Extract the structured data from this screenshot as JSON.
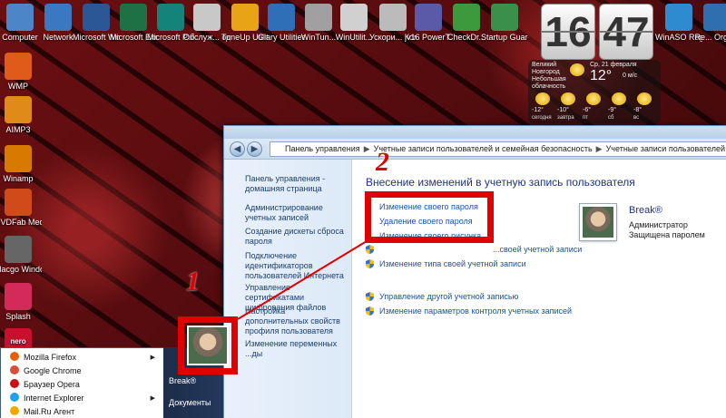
{
  "desktop": {
    "top_icons": [
      {
        "label": "Computer",
        "icon": "computer-icon",
        "color": "#4d86c8"
      },
      {
        "label": "Network",
        "icon": "network-icon",
        "color": "#3a78c2"
      },
      {
        "label": "Microsoft Word 2010",
        "icon": "word-icon",
        "color": "#2b5797"
      },
      {
        "label": "Microsoft Excel 2010",
        "icon": "excel-icon",
        "color": "#1e7145"
      },
      {
        "label": "Microsoft Publish...",
        "icon": "publisher-icon",
        "color": "#14847a"
      },
      {
        "label": "Обслуж... одним ...",
        "icon": "maintenance-icon",
        "color": "#c8c8c8"
      },
      {
        "label": "TuneUp Utiliti...",
        "icon": "tuneup-icon",
        "color": "#e8a317"
      },
      {
        "label": "Glary Utilities 5",
        "icon": "glary-icon",
        "color": "#2e6fb8"
      },
      {
        "label": "WinTun...",
        "icon": "wintune-icon",
        "color": "#a0a0a0"
      },
      {
        "label": "WinUtilit...",
        "icon": "winutilities-icon",
        "color": "#d0d0d0"
      },
      {
        "label": "Ускори... Компь...",
        "icon": "speedup-icon",
        "color": "#bbbbbb"
      },
      {
        "label": "jv16 PowerT...",
        "icon": "jv16-icon",
        "color": "#5a5aa8"
      },
      {
        "label": "CheckDr...",
        "icon": "checkdrive-icon",
        "color": "#3c9a3c"
      },
      {
        "label": "Startup Guard 3",
        "icon": "startup-guard-icon",
        "color": "#3a8f4a"
      },
      {
        "label": "WinASO Registry...",
        "icon": "winaso-icon",
        "color": "#2f8bd0"
      },
      {
        "label": "Re... Orga...",
        "icon": "reg-organizer-icon",
        "color": "#2f6fb0"
      }
    ],
    "left_icons": [
      {
        "label": "WMP",
        "icon": "wmp-icon",
        "color": "#e05a1a"
      },
      {
        "label": "AIMP3",
        "icon": "aimp-icon",
        "color": "#e08a1a"
      },
      {
        "label": "Winamp",
        "icon": "winamp-icon",
        "color": "#d87a00"
      },
      {
        "label": "DVDFab Media...",
        "icon": "dvdfab-icon",
        "color": "#d04a1a"
      },
      {
        "label": "Macgo Windo...",
        "icon": "macgo-icon",
        "color": "#666666"
      },
      {
        "label": "Splash",
        "icon": "splash-icon",
        "color": "#d42a5a"
      },
      {
        "label": "nero",
        "icon": "nero-icon",
        "color": "#c8102e"
      }
    ],
    "wallpaper_color": "#3a0708"
  },
  "gadget": {
    "hour": "16",
    "minute": "47",
    "location": "Великий Новгород Небольшая облачность",
    "date": "Ср, 21 февраля",
    "temp": "12°",
    "wind": "0 м/с",
    "forecast": [
      "-12°",
      "-10°",
      "-6°",
      "-9°",
      "-8°"
    ],
    "forecast_days": [
      "сегодня",
      "завтра",
      "пт",
      "сб",
      "вс"
    ]
  },
  "window": {
    "breadcrumb": [
      "Панель управления",
      "Учетные записи пользователей и семейная безопасность",
      "Учетные записи пользователей"
    ],
    "left_pane": [
      "Панель управления - домашняя страница",
      "Администрирование учетных записей",
      "Создание дискеты сброса пароля",
      "Подключение идентификаторов пользователей Интернета",
      "Управление сертификатами шифрования файлов",
      "Настройка дополнительных свойств профиля пользователя",
      "Изменение переменных ...ды"
    ],
    "heading": "Внесение изменений в учетную запись пользователя",
    "links_boxed": [
      "Изменение своего пароля",
      "Удаление своего пароля",
      "Изменение своего рисунка"
    ],
    "links_shield": [
      "...своей учетной записи",
      "Изменение типа своей учетной записи",
      "Управление другой учетной записью",
      "Изменение параметров контроля учетных записей"
    ],
    "user": {
      "name": "Break®",
      "role": "Администратор",
      "status": "Защищена паролем"
    }
  },
  "annotations": {
    "marker1": "1",
    "marker2": "2",
    "color": "#e00000"
  },
  "start_menu": {
    "items": [
      {
        "label": "Mozilla Firefox",
        "icon": "firefox-icon",
        "color": "#e66000",
        "arrow": "▶"
      },
      {
        "label": "Google Chrome",
        "icon": "chrome-icon",
        "color": "#dd4b39",
        "arrow": ""
      },
      {
        "label": "Браузер Opera",
        "icon": "opera-icon",
        "color": "#cc0f16",
        "arrow": ""
      },
      {
        "label": "Internet Explorer",
        "icon": "ie-icon",
        "color": "#1ea2e8",
        "arrow": "▶"
      },
      {
        "label": "Mail.Ru Агент",
        "icon": "mailru-agent-icon",
        "color": "#f2a900",
        "arrow": ""
      }
    ],
    "right": [
      "Break®",
      "Документы"
    ]
  }
}
